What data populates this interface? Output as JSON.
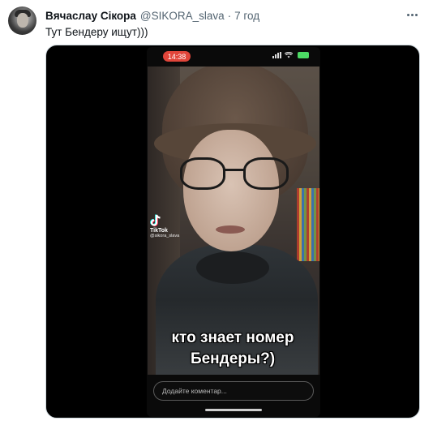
{
  "tweet": {
    "author_name": "Вячаслау Сікора",
    "handle": "@SIKORA_slava",
    "separator": "·",
    "time": "7 год",
    "text": "Тут Бендеру ищут)))",
    "more_icon": "more-horizontal-icon",
    "avatar_icon": "user-avatar"
  },
  "media": {
    "status_time": "14:38",
    "tiktok_label": "TikTok",
    "tiktok_handle": "@sikora_slava",
    "caption_line1": "кто знает номер",
    "caption_line2": "Бендеры?)",
    "comment_placeholder": "Додайте коментар..."
  },
  "colors": {
    "accent_text": "#536471",
    "status_pill": "#e0453a",
    "battery": "#4cd964"
  }
}
